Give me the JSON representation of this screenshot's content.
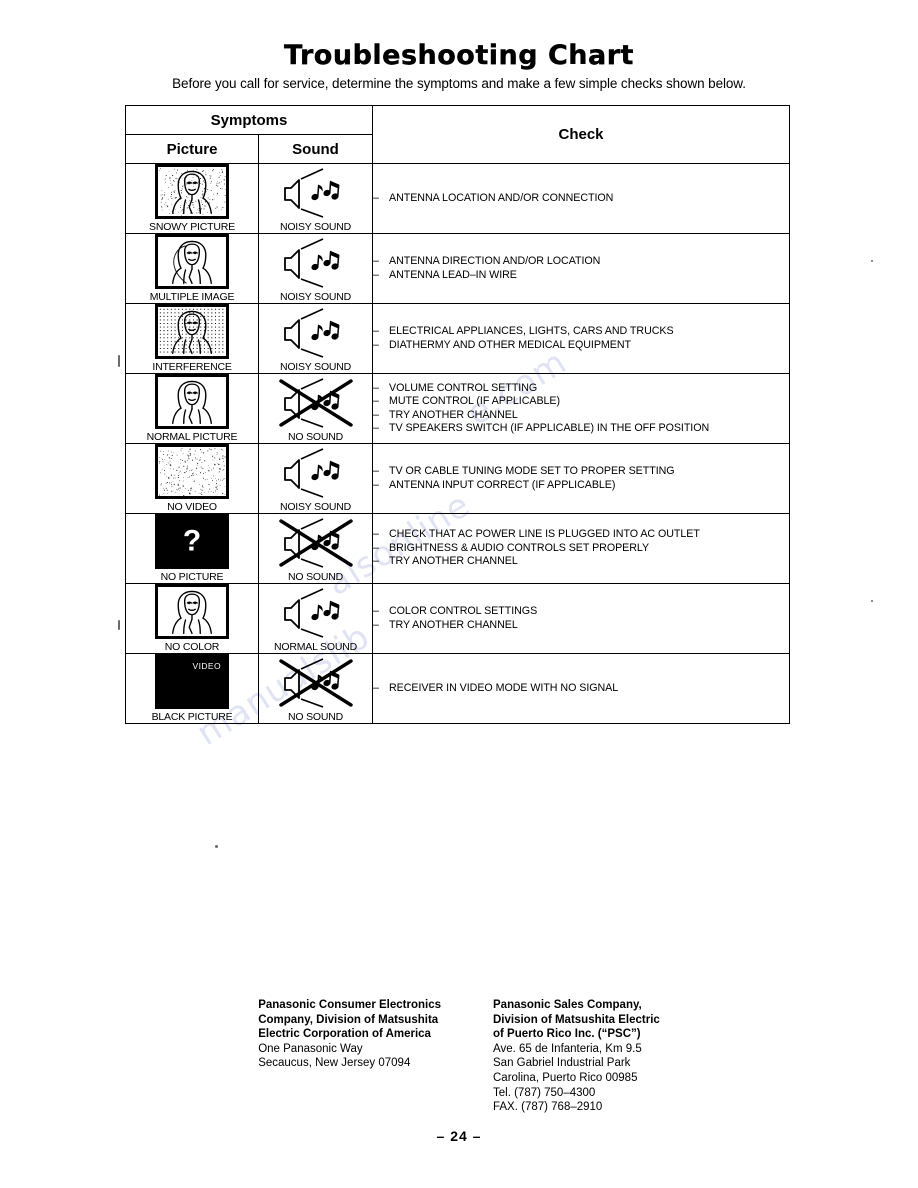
{
  "page": {
    "title": "Troubleshooting Chart",
    "subtitle": "Before you call for service, determine the symptoms and make a few simple checks shown below.",
    "page_number": "– 24 –"
  },
  "table": {
    "headers": {
      "symptoms": "Symptoms",
      "picture": "Picture",
      "sound": "Sound",
      "check": "Check"
    },
    "rows": [
      {
        "picture_icon": "tv-snowy-face-icon",
        "picture_label": "SNOWY PICTURE",
        "sound_icon": "speaker-noisy-icon",
        "sound_label": "NOISY SOUND",
        "checks": [
          "ANTENNA LOCATION AND/OR CONNECTION"
        ]
      },
      {
        "picture_icon": "tv-ghost-face-icon",
        "picture_label": "MULTIPLE IMAGE",
        "sound_icon": "speaker-noisy-icon",
        "sound_label": "NOISY SOUND",
        "checks": [
          "ANTENNA DIRECTION AND/OR LOCATION",
          "ANTENNA LEAD–IN WIRE"
        ]
      },
      {
        "picture_icon": "tv-interference-face-icon",
        "picture_label": "INTERFERENCE",
        "sound_icon": "speaker-noisy-icon",
        "sound_label": "NOISY SOUND",
        "checks": [
          "ELECTRICAL APPLIANCES, LIGHTS, CARS AND TRUCKS",
          "DIATHERMY AND OTHER MEDICAL EQUIPMENT"
        ]
      },
      {
        "picture_icon": "tv-normal-face-icon",
        "picture_label": "NORMAL PICTURE",
        "sound_icon": "speaker-muted-icon",
        "sound_label": "NO SOUND",
        "checks": [
          "VOLUME CONTROL SETTING",
          "MUTE CONTROL (IF APPLICABLE)",
          "TRY ANOTHER CHANNEL",
          "TV SPEAKERS SWITCH (IF APPLICABLE) IN THE OFF POSITION"
        ]
      },
      {
        "picture_icon": "tv-static-only-icon",
        "picture_label": "NO VIDEO",
        "sound_icon": "speaker-noisy-icon",
        "sound_label": "NOISY SOUND",
        "checks": [
          "TV OR CABLE TUNING MODE SET TO PROPER SETTING",
          "ANTENNA INPUT CORRECT (IF APPLICABLE)"
        ]
      },
      {
        "picture_icon": "tv-black-question-icon",
        "picture_label": "NO PICTURE",
        "sound_icon": "speaker-muted-icon",
        "sound_label": "NO SOUND",
        "checks": [
          "CHECK THAT AC POWER LINE  IS PLUGGED  INTO AC OUTLET",
          "BRIGHTNESS & AUDIO CONTROLS SET PROPERLY",
          "TRY ANOTHER CHANNEL"
        ]
      },
      {
        "picture_icon": "tv-outline-face-icon",
        "picture_label": "NO COLOR",
        "sound_icon": "speaker-normal-icon",
        "sound_label": "NORMAL SOUND",
        "checks": [
          "COLOR CONTROL SETTINGS",
          "TRY ANOTHER CHANNEL"
        ]
      },
      {
        "picture_icon": "tv-black-video-icon",
        "picture_label": "BLACK PICTURE",
        "picture_screen_text": "VIDEO",
        "sound_icon": "speaker-muted-icon",
        "sound_label": "NO SOUND",
        "checks": [
          "RECEIVER IN VIDEO MODE WITH NO SIGNAL"
        ]
      }
    ]
  },
  "footer": {
    "left_address": {
      "bold_lines": [
        "Panasonic Consumer Electronics",
        "Company, Division of Matsushita",
        "Electric Corporation of America"
      ],
      "plain_lines": [
        "One Panasonic Way",
        "Secaucus, New Jersey 07094"
      ]
    },
    "right_address": {
      "bold_lines": [
        "Panasonic Sales Company,",
        "Division of Matsushita Electric",
        "of Puerto Rico Inc. (“PSC”)"
      ],
      "plain_lines": [
        "Ave. 65 de Infanteria, Km 9.5",
        "San Gabriel Industrial Park",
        "Carolina, Puerto Rico 00985",
        "Tel. (787) 750–4300",
        "FAX. (787) 768–2910"
      ]
    }
  },
  "watermark": {
    "lines": [
      "e.com",
      "alsonline",
      "manualslib"
    ]
  },
  "colors": {
    "ink": "#000000",
    "paper": "#ffffff",
    "watermark": "#9aa4d8"
  }
}
